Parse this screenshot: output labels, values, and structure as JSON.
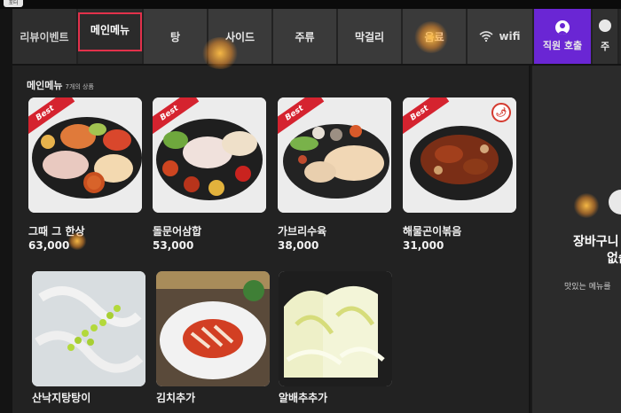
{
  "corner_tag": "포터",
  "tabs": [
    {
      "label": "리뷰이벤트"
    },
    {
      "label": "메인메뉴"
    },
    {
      "label": "탕"
    },
    {
      "label": "사이드"
    },
    {
      "label": "주류"
    },
    {
      "label": "막걸리"
    },
    {
      "label": "음료"
    },
    {
      "label": "wifi"
    }
  ],
  "staff_call": {
    "label": "직원 호출",
    "icon": "person-icon"
  },
  "extra_tab": {
    "label": "주"
  },
  "section": {
    "title": "메인메뉴",
    "count": "7개의 상품"
  },
  "items": [
    {
      "name": "그때 그 한상",
      "price": "63,000",
      "badge": "Best",
      "spicy": false
    },
    {
      "name": "돌문어삼합",
      "price": "53,000",
      "badge": "Best",
      "spicy": false
    },
    {
      "name": "가브리수육",
      "price": "38,000",
      "badge": "Best",
      "spicy": false
    },
    {
      "name": "해물곤이볶음",
      "price": "31,000",
      "badge": "Best",
      "spicy": true
    },
    {
      "name": "산낙지탕탕이",
      "price": ""
    },
    {
      "name": "김치추가",
      "price": ""
    },
    {
      "name": "알배추추가",
      "price": ""
    }
  ],
  "cart": {
    "title_line1": "장바구니",
    "title_line2": "없습",
    "subtitle": "맛있는 메뉴를"
  },
  "colors": {
    "accent_purple": "#6a26d4",
    "best_red": "#d5232f",
    "selected_border": "#e2314b"
  }
}
